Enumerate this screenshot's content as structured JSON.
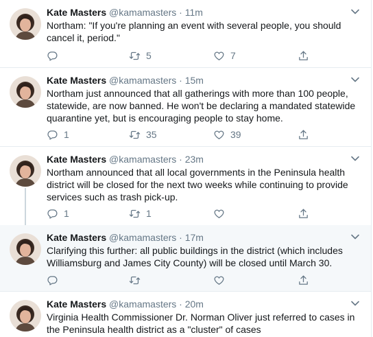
{
  "tweets": [
    {
      "name": "Kate Masters",
      "handle": "@kamamasters",
      "dot": "·",
      "time": "11m",
      "text": "Northam: \"If you're planning an event with several people, you should cancel it, period.\"",
      "reply_count": "",
      "retweet_count": "5",
      "like_count": "7"
    },
    {
      "name": "Kate Masters",
      "handle": "@kamamasters",
      "dot": "·",
      "time": "15m",
      "text": "Northam just announced that all gatherings with more than 100 people, statewide, are now banned. He won't be declaring a mandated statewide quarantine yet, but is encouraging people to stay home.",
      "reply_count": "1",
      "retweet_count": "35",
      "like_count": "39"
    },
    {
      "name": "Kate Masters",
      "handle": "@kamamasters",
      "dot": "·",
      "time": "23m",
      "text": "Northam announced that all local governments in the Peninsula health district will be closed for the next two weeks while continuing to provide services such as trash pick-up.",
      "reply_count": "1",
      "retweet_count": "1",
      "like_count": ""
    },
    {
      "name": "Kate Masters",
      "handle": "@kamamasters",
      "dot": "·",
      "time": "17m",
      "text": "Clarifying this further: all public buildings in the district (which includes Williamsburg and James City County) will be closed until March 30.",
      "reply_count": "",
      "retweet_count": "",
      "like_count": ""
    },
    {
      "name": "Kate Masters",
      "handle": "@kamamasters",
      "dot": "·",
      "time": "20m",
      "text": "Virginia Health Commissioner Dr. Norman Oliver just referred to cases in the Peninsula health district as a \"cluster\" of cases",
      "reply_count": "",
      "retweet_count": "",
      "like_count": ""
    }
  ],
  "icons": {
    "reply": "reply-icon",
    "retweet": "retweet-icon",
    "like": "heart-icon",
    "share": "share-icon",
    "menu": "chevron-down-icon"
  },
  "colors": {
    "text": "#14171a",
    "secondary": "#657786",
    "border": "#e6ecf0",
    "thread_line": "#ccd6dd",
    "highlight_bg": "#f5f8fa"
  }
}
